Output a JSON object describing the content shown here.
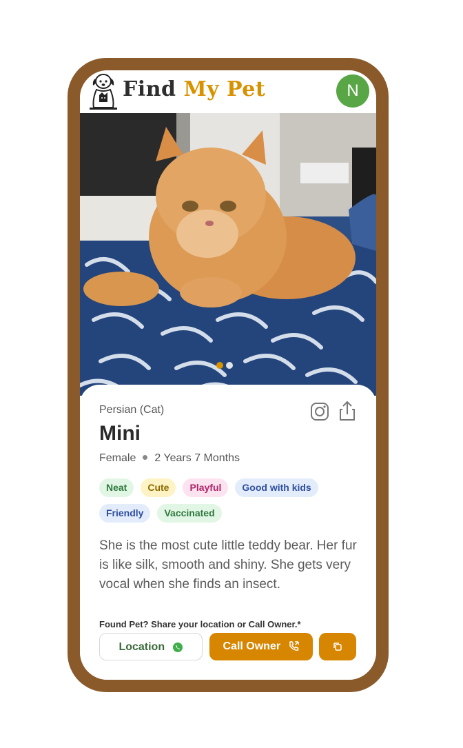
{
  "app": {
    "brand_word1": "Find",
    "brand_word2": "My Pet",
    "avatar_initial": "N",
    "colors": {
      "frame": "#8a5a2b",
      "accent": "#d68600",
      "avatar": "#59a646"
    }
  },
  "carousel": {
    "total_slides": 2,
    "active_index": 0
  },
  "pet": {
    "breed": "Persian (Cat)",
    "name": "Mini",
    "gender": "Female",
    "age": "2 Years 7 Months",
    "tags": [
      {
        "label": "Neat",
        "bg": "#e2f6e6",
        "fg": "#2f7a3c"
      },
      {
        "label": "Cute",
        "bg": "#fdf3c4",
        "fg": "#8a6a00"
      },
      {
        "label": "Playful",
        "bg": "#fde3ef",
        "fg": "#b0256a"
      },
      {
        "label": "Good with kids",
        "bg": "#e3ecfb",
        "fg": "#2f4fa0"
      },
      {
        "label": "Friendly",
        "bg": "#e3ecfb",
        "fg": "#2f4fa0"
      },
      {
        "label": "Vaccinated",
        "bg": "#e2f6e6",
        "fg": "#2f7a3c"
      }
    ],
    "description": "She is the most cute little teddy bear. Her fur is like silk, smooth and shiny. She gets very vocal when she finds an insect."
  },
  "actions": {
    "prompt": "Found Pet? Share your location or Call Owner.*",
    "location_label": "Location",
    "call_label": "Call Owner"
  }
}
